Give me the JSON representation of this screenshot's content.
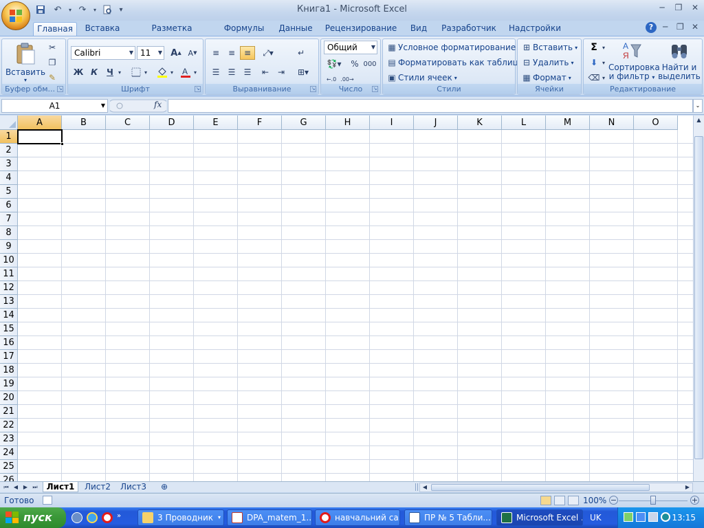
{
  "window": {
    "title": "Книга1 - Microsoft Excel"
  },
  "tabs": [
    "Главная",
    "Вставка",
    "Разметка страницы",
    "Формулы",
    "Данные",
    "Рецензирование",
    "Вид",
    "Разработчик",
    "Надстройки"
  ],
  "ribbon": {
    "clipboard": {
      "label": "Буфер обм...",
      "paste": "Вставить"
    },
    "font": {
      "label": "Шрифт",
      "name": "Calibri",
      "size": "11",
      "bold": "Ж",
      "italic": "К",
      "underline": "Ч"
    },
    "alignment": {
      "label": "Выравнивание"
    },
    "number": {
      "label": "Число",
      "format": "Общий",
      "percent": "%",
      "thousands": "000"
    },
    "styles": {
      "label": "Стили",
      "conditional": "Условное форматирование",
      "as_table": "Форматировать как таблицу",
      "cell_styles": "Стили ячеек"
    },
    "cells": {
      "label": "Ячейки",
      "insert": "Вставить",
      "delete": "Удалить",
      "format": "Формат"
    },
    "editing": {
      "label": "Редактирование",
      "sort_l1": "Сортировка",
      "sort_l2": "и фильтр",
      "find_l1": "Найти и",
      "find_l2": "выделить",
      "sigma": "Σ"
    }
  },
  "formula_bar": {
    "name_box": "A1",
    "fx": "fx",
    "value": ""
  },
  "grid": {
    "columns": [
      "A",
      "B",
      "C",
      "D",
      "E",
      "F",
      "G",
      "H",
      "I",
      "J",
      "K",
      "L",
      "M",
      "N",
      "O"
    ],
    "rows": [
      "1",
      "2",
      "3",
      "4",
      "5",
      "6",
      "7",
      "8",
      "9",
      "10",
      "11",
      "12",
      "13",
      "14",
      "15",
      "16",
      "17",
      "18",
      "19",
      "20",
      "21",
      "22",
      "23",
      "24",
      "25",
      "26"
    ],
    "active_cell": "A1"
  },
  "sheets": [
    "Лист1",
    "Лист2",
    "Лист3"
  ],
  "status": {
    "text": "Готово",
    "zoom": "100%"
  },
  "taskbar": {
    "start": "пуск",
    "buttons": [
      "3 Проводник",
      "DPA_matem_1...",
      "навчальний са...",
      "ПР № 5 Табли...",
      "Microsoft Excel ..."
    ],
    "lang": "UK",
    "clock": "13:15"
  },
  "colors": {
    "accent": "#15428b",
    "selected_header": "#f1c15f",
    "gridline": "#d0d7e5"
  }
}
